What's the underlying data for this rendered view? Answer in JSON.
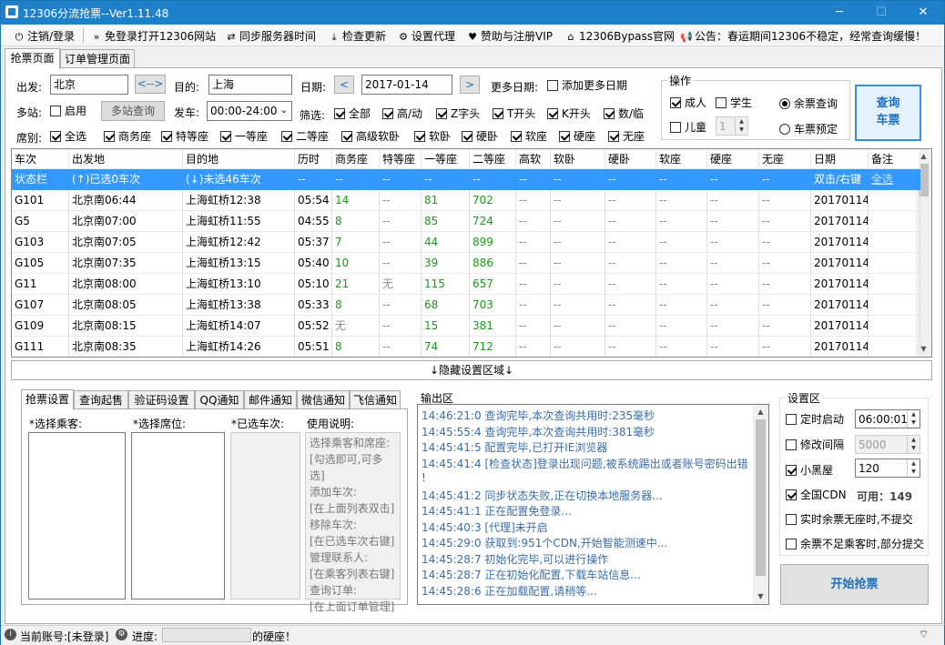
{
  "window": {
    "title": "12306分流抢票--Ver1.11.48",
    "min": "─",
    "max": "☐",
    "close": "✕"
  },
  "toolbar": [
    {
      "icon": "⏻",
      "label": "注销/登录"
    },
    {
      "icon": "»",
      "label": "免登录打开12306网站"
    },
    {
      "icon": "⇄",
      "label": "同步服务器时间"
    },
    {
      "icon": "⤓",
      "label": "检查更新"
    },
    {
      "icon": "⚙",
      "label": "设置代理"
    },
    {
      "icon": "♥",
      "label": "赞助与注册VIP"
    },
    {
      "icon": "⌂",
      "label": "12306Bypass官网"
    },
    {
      "icon": "📢",
      "label": "公告：春运期间12306不稳定，经常查询缓慢！"
    }
  ],
  "tabs": [
    "抢票页面",
    "订单管理页面"
  ],
  "query": {
    "from_label": "出发:",
    "from": "北京",
    "swap": "<-->",
    "to_label": "目的:",
    "to": "上海",
    "date_label": "日期:",
    "date": "2017-01-14",
    "prev": "<",
    "next": ">",
    "more_dates_label": "更多日期:",
    "add_dates": "添加更多日期",
    "multi_label": "多站:",
    "enable": "启用",
    "multi_query": "多站查询",
    "depart_label": "发车:",
    "depart": "00:00-24:00",
    "filter_label": "筛选:",
    "filters": [
      "全部",
      "高/动",
      "Z字头",
      "T开头",
      "K开头",
      "数/临"
    ],
    "seat_label": "席别:",
    "seats": [
      "全选",
      "商务座",
      "特等座",
      "一等座",
      "二等座",
      "高级软卧",
      "软卧",
      "硬卧",
      "软座",
      "硬座",
      "无座"
    ]
  },
  "ops": {
    "title": "操作",
    "adult": "成人",
    "student": "学生",
    "child": "儿童",
    "child_count": "1",
    "remaining": "余票查询",
    "reserve": "车票预定",
    "query_btn": [
      "查询",
      "车票"
    ]
  },
  "grid": {
    "headers": [
      "车次",
      "出发地",
      "目的地",
      "历时",
      "商务座",
      "特等座",
      "一等座",
      "二等座",
      "高软",
      "软卧",
      "硬卧",
      "软座",
      "硬座",
      "无座",
      "日期",
      "备注"
    ],
    "status_row": [
      "状态栏",
      "(↑)已选0车次",
      "(↓)未选46车次",
      "--",
      "--",
      "--",
      "--",
      "--",
      "--",
      "--",
      "--",
      "--",
      "--",
      "--",
      "双击/右键",
      "全选"
    ],
    "rows": [
      [
        "G101",
        "北京南06:44",
        "上海虹桥12:38",
        "05:54",
        "14",
        "--",
        "81",
        "702",
        "--",
        "--",
        "--",
        "--",
        "--",
        "--",
        "20170114",
        ""
      ],
      [
        "G5",
        "北京南07:00",
        "上海虹桥11:55",
        "04:55",
        "8",
        "--",
        "85",
        "724",
        "--",
        "--",
        "--",
        "--",
        "--",
        "--",
        "20170114",
        ""
      ],
      [
        "G103",
        "北京南07:05",
        "上海虹桥12:42",
        "05:37",
        "7",
        "--",
        "44",
        "899",
        "--",
        "--",
        "--",
        "--",
        "--",
        "--",
        "20170114",
        ""
      ],
      [
        "G105",
        "北京南07:35",
        "上海虹桥13:15",
        "05:40",
        "10",
        "--",
        "39",
        "886",
        "--",
        "--",
        "--",
        "--",
        "--",
        "--",
        "20170114",
        ""
      ],
      [
        "G11",
        "北京南08:00",
        "上海虹桥13:10",
        "05:10",
        "21",
        "无",
        "115",
        "657",
        "--",
        "--",
        "--",
        "--",
        "--",
        "--",
        "20170114",
        ""
      ],
      [
        "G107",
        "北京南08:05",
        "上海虹桥13:38",
        "05:33",
        "8",
        "--",
        "68",
        "703",
        "--",
        "--",
        "--",
        "--",
        "--",
        "--",
        "20170114",
        ""
      ],
      [
        "G109",
        "北京南08:15",
        "上海虹桥14:07",
        "05:52",
        "无",
        "--",
        "15",
        "381",
        "--",
        "--",
        "--",
        "--",
        "--",
        "--",
        "20170114",
        ""
      ],
      [
        "G111",
        "北京南08:35",
        "上海虹桥14:26",
        "05:51",
        "8",
        "--",
        "74",
        "712",
        "--",
        "--",
        "--",
        "--",
        "--",
        "--",
        "20170114",
        ""
      ]
    ]
  },
  "hide_settings": "↓隐藏设置区域↓",
  "subtabs": [
    "抢票设置",
    "查询起售",
    "验证码设置",
    "QQ通知",
    "邮件通知",
    "微信通知",
    "飞信通知"
  ],
  "settings": {
    "passengers": "*选择乘客:",
    "seats": "*选择席位:",
    "trains": "*已选车次:",
    "help_title": "使用说明:",
    "help": [
      "选择乘客和席座:",
      "[勾选即可,可多选]",
      "添加车次:",
      "[在上面列表双击]",
      "移除车次:",
      "[在已选车次右键]",
      "管理联系人:",
      "[在乘客列表右键]",
      "查询订单:",
      "[在上面订单管理]"
    ]
  },
  "output": {
    "title": "输出区",
    "lines": [
      "14:46:21:0  查询完毕,本次查询共用时:235毫秒",
      "14:45:55:4  查询完毕,本次查询共用时:381毫秒",
      "14:45:41:5  配置完毕,已打开IE浏览器",
      "14:45:41:4  [检查状态]登录出现问题,被系统踢出或者账号密码出错",
      "!",
      "14:45:41:2  同步状态失败,正在切换本地服务器...",
      "14:45:41:1  正在配置免登录...",
      "14:45:40:3  [代理]未开启",
      "14:45:29:0  获取到:951个CDN,开始智能测速中...",
      "14:45:28:7  初始化完毕,可以进行操作",
      "14:45:28:7  正在初始化配置,下载车站信息...",
      "14:45:28:6  正在加载配置,请稍等..."
    ]
  },
  "setting_area": {
    "title": "设置区",
    "timer": "定时启动",
    "timer_val": "06:00:01",
    "interval": "修改间隔",
    "interval_val": "5000",
    "blackroom": "小黑屋",
    "blackroom_val": "120",
    "cdn": "全国CDN",
    "cdn_avail": "可用：149",
    "no_seat": "实时余票无座时,不提交",
    "partial": "余票不足乘客时,部分提交",
    "start": "开始抢票"
  },
  "status": {
    "account": "当前账号:[未登录]",
    "progress": "进度:",
    "msg": "的硬座！"
  },
  "colors": {
    "title_bar": "#1e80c8",
    "selected_row": "#3399ff",
    "green": "#1a9a1a",
    "log_text": "#3a6ea8"
  }
}
